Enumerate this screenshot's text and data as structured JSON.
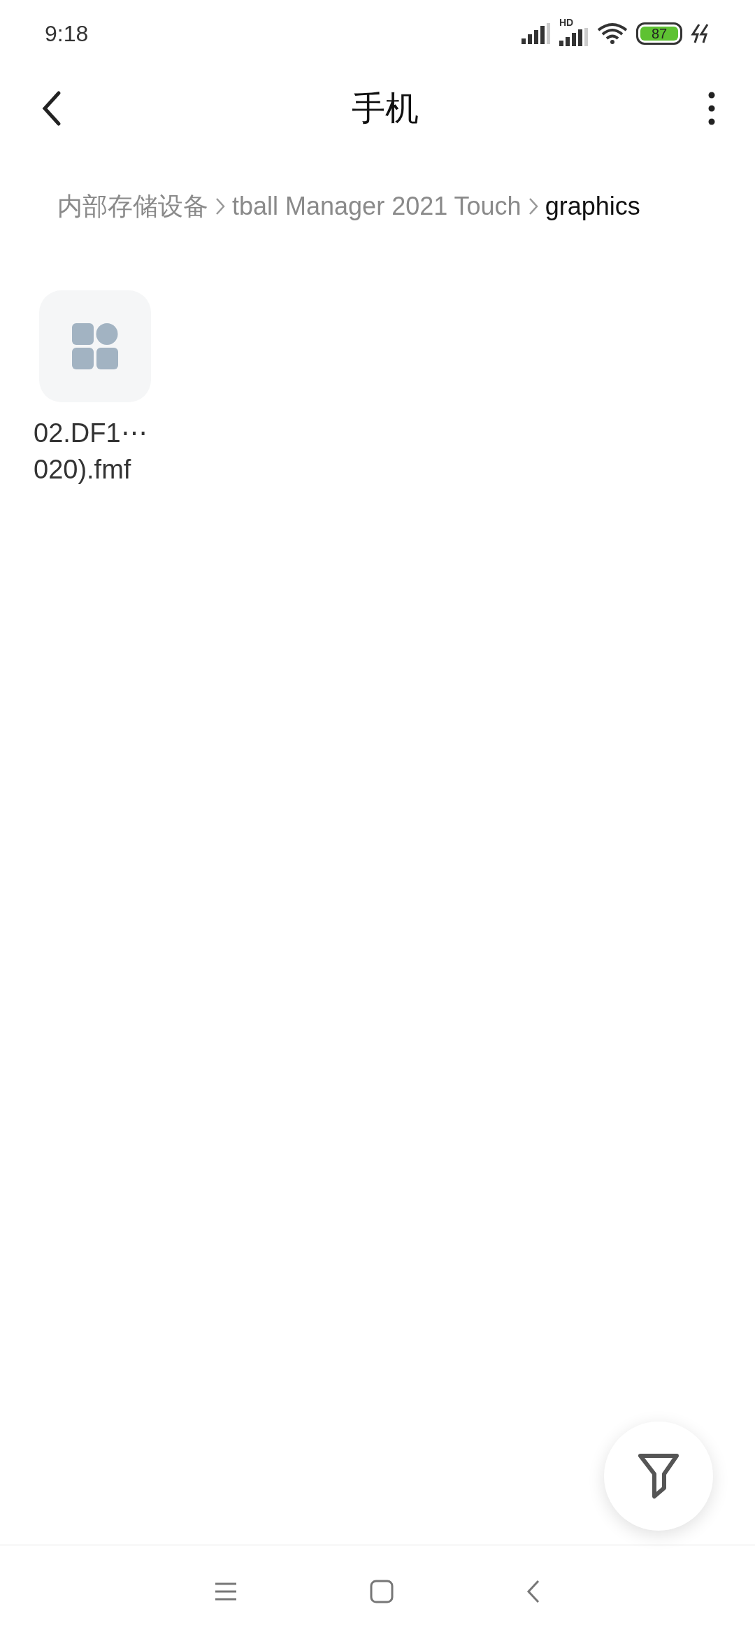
{
  "status_bar": {
    "time": "9:18",
    "network_label": "HD",
    "battery": "87",
    "charging": true
  },
  "header": {
    "title": "手机"
  },
  "breadcrumb": [
    {
      "label": "内部存储设备",
      "current": false
    },
    {
      "label": "tball Manager 2021 Touch",
      "current": false
    },
    {
      "label": "graphics",
      "current": true
    }
  ],
  "files": [
    {
      "name_lines": [
        "02.DF1⋯",
        "020).fmf"
      ]
    }
  ]
}
